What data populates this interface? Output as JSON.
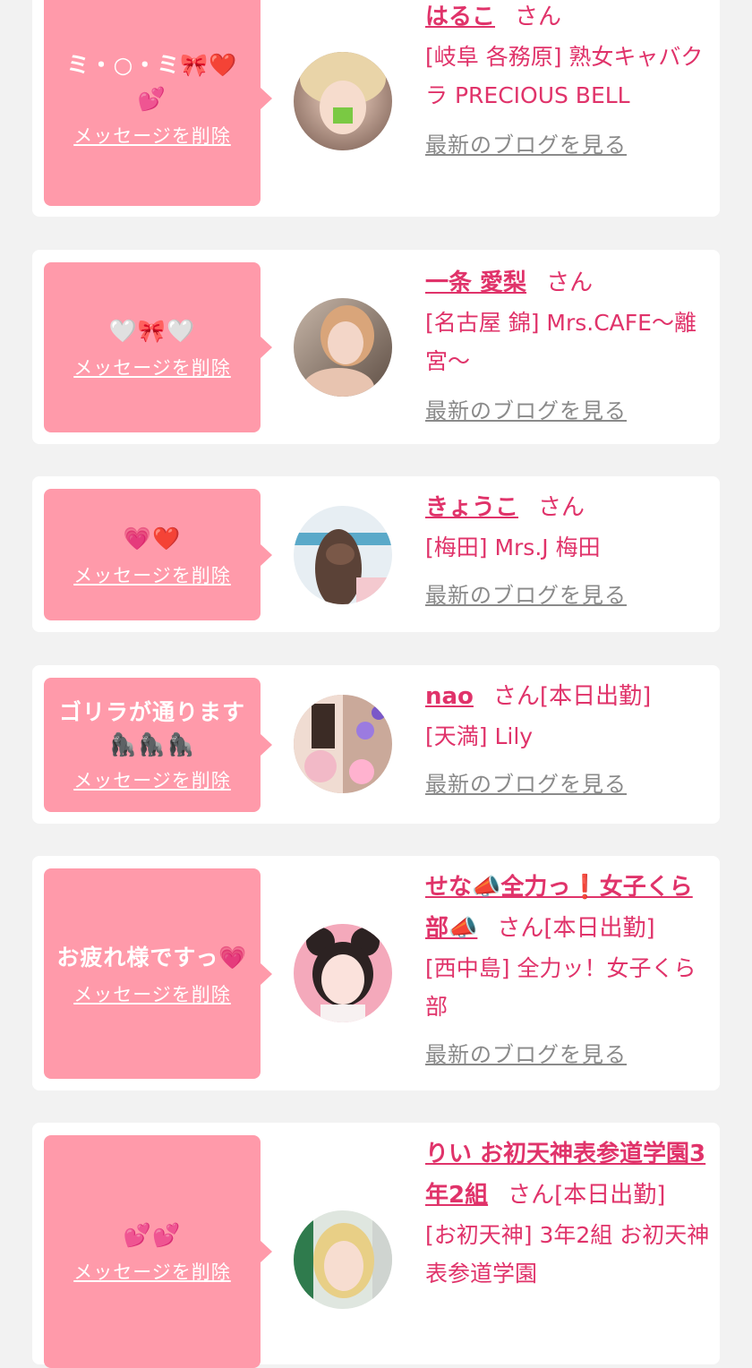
{
  "cards": [
    {
      "message": "ミ・○・ミ🎀❤️💕",
      "delete_label": "メッセージを削除",
      "name": "はるこ",
      "san": "さん",
      "shop": "[岐阜 各務原] 熟女キャバクラ PRECIOUS BELL",
      "blog": "最新のブログを見る"
    },
    {
      "message": "🤍🎀🤍",
      "delete_label": "メッセージを削除",
      "name": "一条 愛梨",
      "san": "さん",
      "shop": "[名古屋 錦] Mrs.CAFE〜離宮〜",
      "blog": "最新のブログを見る"
    },
    {
      "message": "💗❤️",
      "delete_label": "メッセージを削除",
      "name": "きょうこ",
      "san": "さん",
      "shop": "[梅田] Mrs.J 梅田",
      "blog": "最新のブログを見る"
    },
    {
      "message": "ゴリラが通ります🦍🦍🦍",
      "delete_label": "メッセージを削除",
      "name": "nao",
      "san": "さん[本日出勤]",
      "shop": "[天満] Lily",
      "blog": "最新のブログを見る"
    },
    {
      "message": "お疲れ様ですっ💗",
      "delete_label": "メッセージを削除",
      "name": "せな📣全力っ❗️女子くら部📣",
      "san": "さん[本日出勤]",
      "shop": "[西中島] 全力ッ！女子くら部",
      "blog": "最新のブログを見る"
    },
    {
      "message": "💕💕",
      "delete_label": "メッセージを削除",
      "name": "りい お初天神表参道学園3年2組",
      "san": "さん[本日出勤]",
      "shop": "[お初天神] 3年2組 お初天神表参道学園",
      "blog": ""
    }
  ]
}
